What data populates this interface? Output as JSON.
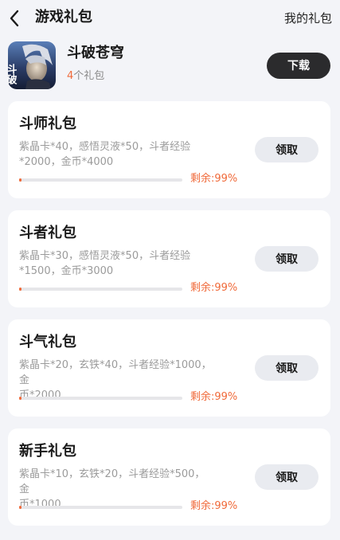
{
  "header": {
    "title": "游戏礼包",
    "my_gifts_label": "我的礼包"
  },
  "game": {
    "name": "斗破苍穹",
    "gift_count_num": "4",
    "gift_count_suffix": "个礼包",
    "icon_text": "斗破",
    "download_label": "下载"
  },
  "packages": [
    {
      "title": "斗师礼包",
      "desc_line1": "紫晶卡*40，感悟灵液*50，斗者经验",
      "desc_line2": "*2000，金币*4000",
      "remain_label": "剩余:99%",
      "remain_fraction": 0.99,
      "claim_label": "领取"
    },
    {
      "title": "斗者礼包",
      "desc_line1": "紫晶卡*30，感悟灵液*50，斗者经验",
      "desc_line2": "*1500，金币*3000",
      "remain_label": "剩余:99%",
      "remain_fraction": 0.99,
      "claim_label": "领取"
    },
    {
      "title": "斗气礼包",
      "desc_line1": "紫晶卡*20，玄铁*40，斗者经验*1000，金",
      "desc_line2": "币*2000",
      "remain_label": "剩余:99%",
      "remain_fraction": 0.99,
      "claim_label": "领取"
    },
    {
      "title": "新手礼包",
      "desc_line1": "紫晶卡*10，玄铁*20，斗者经验*500，金",
      "desc_line2": "币*1000",
      "remain_label": "剩余:99%",
      "remain_fraction": 0.99,
      "claim_label": "领取"
    }
  ],
  "colors": {
    "accent": "#f06a3a",
    "download_bg": "#2b2b2d",
    "claim_bg": "#e9ebf0",
    "page_bg": "#f3f4f8"
  },
  "icons": {
    "back": "chevron-left-icon"
  }
}
